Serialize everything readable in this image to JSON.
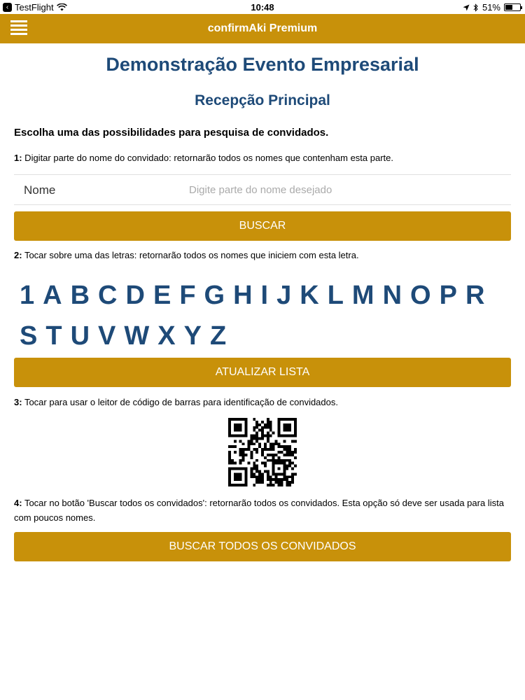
{
  "status_bar": {
    "carrier": "TestFlight",
    "time": "10:48",
    "battery": "51%",
    "battery_level": 0.51
  },
  "nav": {
    "title": "confirmAki Premium",
    "menu_icon": "hamburger-menu-icon"
  },
  "header": {
    "title": "Demonstração Evento Empresarial",
    "subtitle": "Recepção Principal"
  },
  "intro": "Escolha uma das possibilidades para pesquisa de convidados.",
  "step1": {
    "number": "1:",
    "text": " Digitar parte do nome do convidado: retornarão todos os nomes que contenham esta parte."
  },
  "search": {
    "label": "Nome",
    "placeholder": "Digite parte do nome desejado",
    "value": ""
  },
  "buttons": {
    "buscar": "BUSCAR",
    "atualizar": "ATUALIZAR LISTA",
    "buscar_todos": "BUSCAR TODOS OS CONVIDADOS"
  },
  "step2": {
    "number": "2:",
    "text": " Tocar sobre uma das letras: retornarão todos os nomes que iniciem com esta letra."
  },
  "letters": [
    "1",
    "A",
    "B",
    "C",
    "D",
    "E",
    "F",
    "G",
    "H",
    "I",
    "J",
    "K",
    "L",
    "M",
    "N",
    "O",
    "P",
    "R",
    "S",
    "T",
    "U",
    "V",
    "W",
    "X",
    "Y",
    "Z"
  ],
  "step3": {
    "number": "3:",
    "text": " Tocar para usar o leitor de código de barras para identificação de convidados."
  },
  "step4": {
    "number": "4:",
    "text": " Tocar no botão 'Buscar todos os convidados': retornarão todos os convidados. Esta opção só deve ser usada para lista com poucos nomes."
  },
  "colors": {
    "accent": "#c8910a",
    "title": "#1e4a78"
  }
}
